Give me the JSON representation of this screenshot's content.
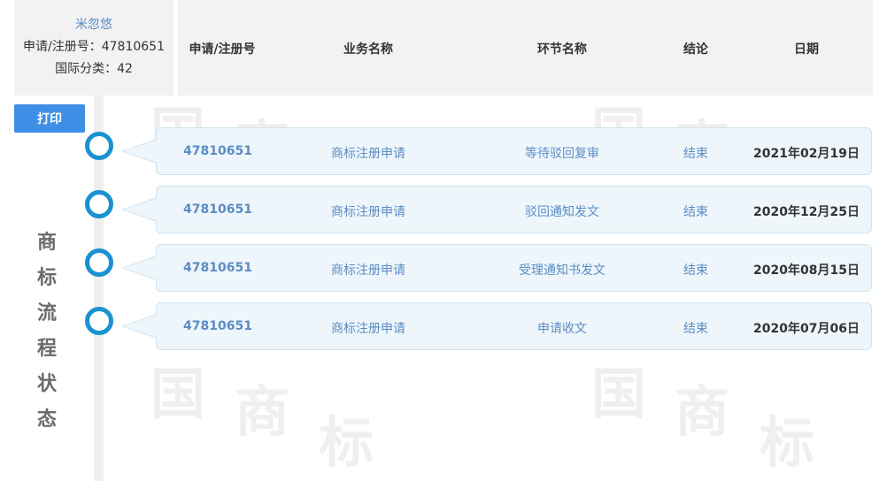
{
  "owner": {
    "name": "米忽悠",
    "reg_no_label": "申请/注册号：",
    "reg_no": "47810651",
    "class_label": "国际分类：",
    "class_value": "42"
  },
  "columns": [
    "申请/注册号",
    "业务名称",
    "环节名称",
    "结论",
    "日期"
  ],
  "print_label": "打印",
  "side_title": [
    "商",
    "标",
    "流",
    "程",
    "状",
    "态"
  ],
  "rows": [
    {
      "no": "47810651",
      "business": "商标注册申请",
      "step": "等待驳回复审",
      "result": "结束",
      "date": "2021年02月19日"
    },
    {
      "no": "47810651",
      "business": "商标注册申请",
      "step": "驳回通知发文",
      "result": "结束",
      "date": "2020年12月25日"
    },
    {
      "no": "47810651",
      "business": "商标注册申请",
      "step": "受理通知书发文",
      "result": "结束",
      "date": "2020年08月15日"
    },
    {
      "no": "47810651",
      "business": "商标注册申请",
      "step": "申请收文",
      "result": "结束",
      "date": "2020年07月06日"
    }
  ],
  "colors": {
    "accent": "#3e8ee6",
    "timeline_dot": "#1a92d0",
    "link": "#5b8cc4"
  }
}
